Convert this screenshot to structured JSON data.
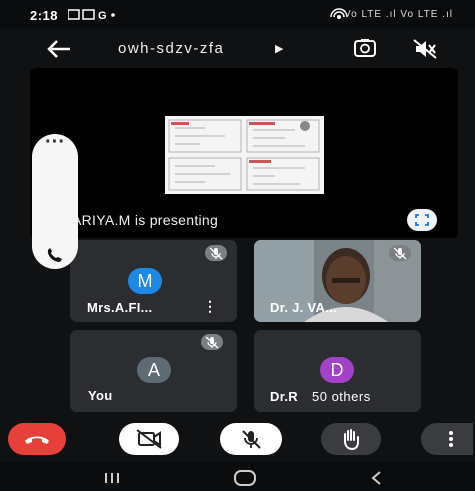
{
  "status_bar": {
    "time": "2:18",
    "right_indicators": "Vo LTE .ıl Vo LTE .ıl"
  },
  "app_bar": {
    "meeting_code": "owh-sdzv-zfa",
    "back_icon": "arrow-left-icon",
    "switch_camera_icon": "camera-switch-icon",
    "audio_icon": "speaker-off-icon"
  },
  "presentation": {
    "presenter_text": "ARIYA.M is presenting",
    "fullscreen_icon": "fullscreen-icon"
  },
  "participants": [
    {
      "name": "Mrs.A.FI...",
      "avatar_letter": "M",
      "avatar_color": "#1e88e5",
      "muted": true
    },
    {
      "name": "Dr. J. VA...",
      "video": true,
      "muted": true
    },
    {
      "name": "You",
      "avatar_letter": "A",
      "avatar_color": "#5f6b73",
      "muted": true
    },
    {
      "name": "Dr.R",
      "avatar_letter": "D",
      "avatar_color": "#a142c7",
      "overflow_label": "50 others"
    }
  ],
  "controls": {
    "end_call_icon": "phone-hangup-icon",
    "camera_icon": "camera-off-icon",
    "mic_icon": "mic-off-icon",
    "hand_icon": "raise-hand-icon",
    "more_icon": "more-vertical-icon"
  },
  "colors": {
    "end_call": "#e5413a",
    "background": "#0f1113",
    "tile": "#2b2d30"
  }
}
